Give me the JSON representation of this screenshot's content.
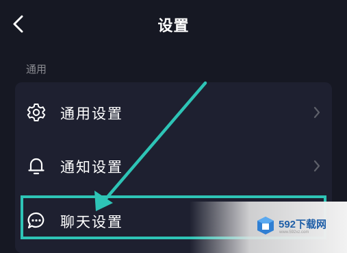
{
  "header": {
    "title": "设置",
    "back_icon": "chevron-left-icon"
  },
  "section": {
    "label": "通用"
  },
  "settings_items": [
    {
      "label": "通用设置",
      "icon": "gear-icon"
    },
    {
      "label": "通知设置",
      "icon": "bell-icon"
    },
    {
      "label": "聊天设置",
      "icon": "chat-bubble-icon"
    }
  ],
  "annotation": {
    "highlight_color": "#2ec4b6",
    "highlighted_item": "聊天设置"
  },
  "watermark": {
    "text": "592下载网",
    "subtext": "www.592xz.com"
  },
  "colors": {
    "background": "#161823",
    "card": "#1e2030",
    "text": "#ffffff",
    "muted": "#8a8b91",
    "accent": "#2ec4b6"
  }
}
